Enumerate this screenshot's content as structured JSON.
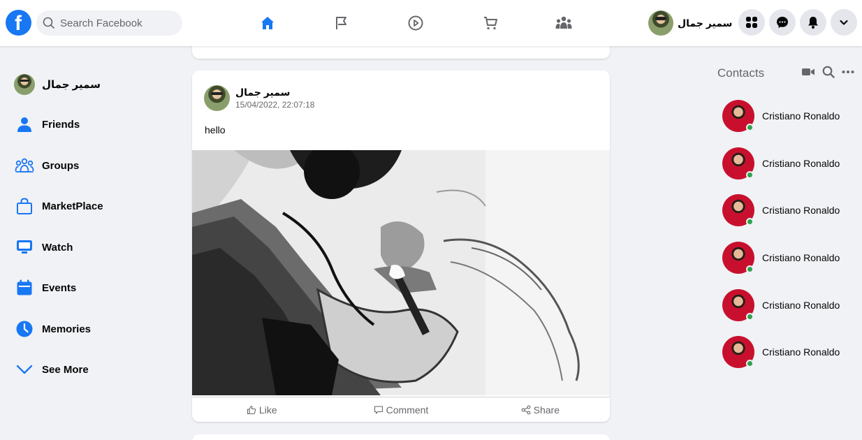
{
  "header": {
    "logo_letter": "f",
    "search_placeholder": "Search Facebook",
    "nav_icons": [
      "home-icon",
      "flag-icon",
      "watch-icon",
      "marketplace-icon",
      "groups-icon"
    ],
    "profile_name": "سمير جمال",
    "action_icons": [
      "menu-grid-icon",
      "messenger-icon",
      "bell-icon",
      "chevron-down-icon"
    ],
    "accent_color": "#1877f2"
  },
  "sidebar": {
    "profile_name": "سمير جمال",
    "items": [
      {
        "label": "Friends",
        "icon": "friends-icon"
      },
      {
        "label": "Groups",
        "icon": "groups-icon"
      },
      {
        "label": "MarketPlace",
        "icon": "marketplace-icon"
      },
      {
        "label": "Watch",
        "icon": "watch-icon"
      },
      {
        "label": "Events",
        "icon": "events-icon"
      },
      {
        "label": "Memories",
        "icon": "memories-icon"
      },
      {
        "label": "See More",
        "icon": "chevron-down-icon"
      }
    ]
  },
  "post": {
    "author": "سمير جمال",
    "timestamp": "15/04/2022, 22:07:18",
    "text": "hello",
    "image_icon": "sketch-portrait-image",
    "actions": {
      "like": "Like",
      "comment": "Comment",
      "share": "Share"
    }
  },
  "contacts": {
    "title": "Contacts",
    "tool_icons": [
      "video-icon",
      "search-icon",
      "more-icon"
    ],
    "list": [
      {
        "name": "Cristiano Ronaldo",
        "online": true
      },
      {
        "name": "Cristiano Ronaldo",
        "online": true
      },
      {
        "name": "Cristiano Ronaldo",
        "online": true
      },
      {
        "name": "Cristiano Ronaldo",
        "online": true
      },
      {
        "name": "Cristiano Ronaldo",
        "online": true
      },
      {
        "name": "Cristiano Ronaldo",
        "online": true
      }
    ]
  }
}
